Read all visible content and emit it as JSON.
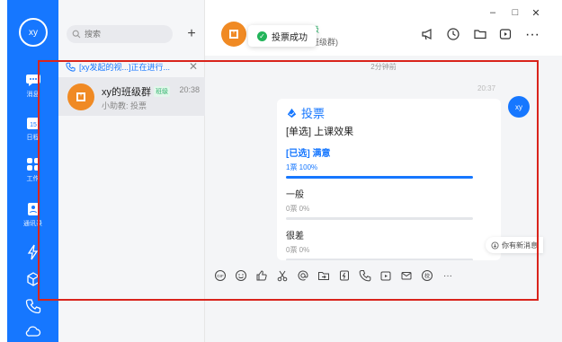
{
  "user": {
    "avatar_text": "xy"
  },
  "rail": {
    "items": [
      {
        "label": "消息"
      },
      {
        "label": "日程",
        "badge": "15"
      },
      {
        "label": "工作"
      },
      {
        "label": "通讯录"
      }
    ]
  },
  "convlist": {
    "search_placeholder": "搜索",
    "add_label": "+",
    "live_banner": "[xy发起的视...]正在进行...",
    "conversation": {
      "name": "xy的班级群",
      "tag": "班级",
      "time": "20:38",
      "preview": "小助教: 投票"
    }
  },
  "chat": {
    "header_title_fragment": "级",
    "header_sub_fragment": "班级群)",
    "toast": "投票成功",
    "window_controls": [
      "–",
      "□",
      "✕"
    ],
    "timestamp": "2分钟前",
    "message_time": "20:37",
    "me_avatar_text": "xy",
    "vote_card": {
      "title": "投票",
      "question": "[单选] 上课效果",
      "options": [
        {
          "name": "[已选] 满意",
          "stat": "1票  100%",
          "selected": true,
          "fraction": 1.0
        },
        {
          "name": "一般",
          "stat": "0票  0%",
          "selected": false,
          "fraction": 0
        },
        {
          "name": "很差",
          "stat": "0票  0%",
          "selected": false,
          "fraction": 0
        }
      ]
    },
    "new_message_hint": "你有新消息",
    "toolbar_more": "···",
    "header_more": "···"
  },
  "colors": {
    "brand_blue": "#1677ff",
    "group_orange": "#f08a24",
    "tag_green": "#2fb36b",
    "highlight_red": "#d9241c"
  }
}
